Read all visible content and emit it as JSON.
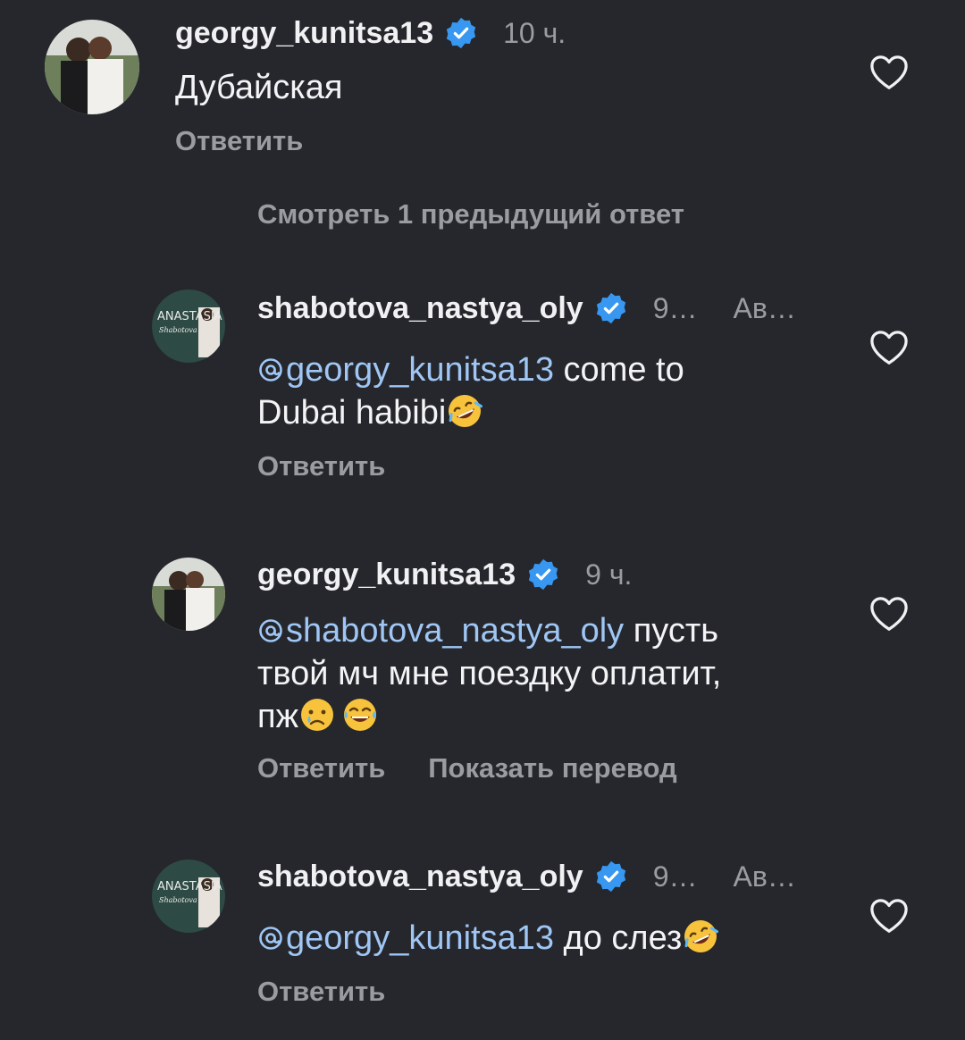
{
  "comments": [
    {
      "username": "georgy_kunitsa13",
      "time": "10 ч.",
      "text": "Дубайская",
      "reply_label": "Ответить"
    },
    {
      "username": "shabotova_nastya_oly",
      "time": "9…",
      "author_tag": "Ав…",
      "avatar_text_main": "ANASTASIA",
      "avatar_text_sub": "Shabotova",
      "mention": "georgy_kunitsa13",
      "text_line1_rest": " come to",
      "text_line2": "Dubai habibi",
      "reply_label": "Ответить"
    },
    {
      "username": "georgy_kunitsa13",
      "time": "9 ч.",
      "mention": "shabotova_nastya_oly",
      "text_line1_rest": " пусть",
      "text_line2": "твой мч мне поездку оплатит,",
      "text_line3": "пж",
      "reply_label": "Ответить",
      "translate_label": "Показать перевод"
    },
    {
      "username": "shabotova_nastya_oly",
      "time": "9…",
      "author_tag": "Ав…",
      "avatar_text_main": "ANASTASIA",
      "avatar_text_sub": "Shabotova",
      "mention": "georgy_kunitsa13",
      "text_line1_rest": " до слез",
      "reply_label": "Ответить"
    }
  ],
  "view_previous_replies": "Смотреть 1 предыдущий ответ",
  "colors": {
    "background": "#25272c",
    "verified": "#3897f0",
    "mention": "#9fc6f4",
    "muted": "#9a9ca1"
  },
  "icons": [
    "verified-badge-icon",
    "heart-icon",
    "threads-mention-icon"
  ]
}
